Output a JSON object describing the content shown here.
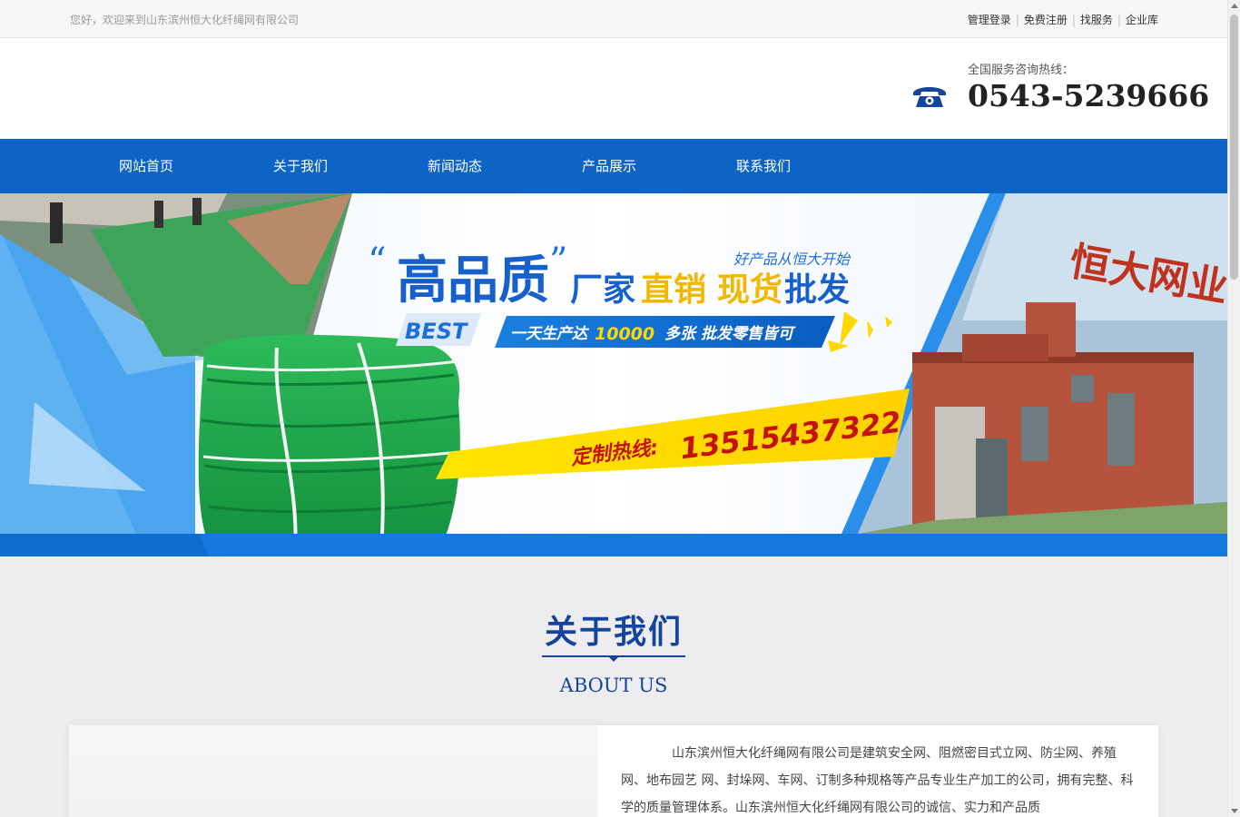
{
  "topbar": {
    "welcome": "您好，欢迎来到山东滨州恒大化纤绳网有限公司",
    "links": [
      "管理登录",
      "免费注册",
      "找服务",
      "企业库"
    ]
  },
  "header": {
    "hotline_label": "全国服务咨询热线：",
    "hotline_number": "0543-5239666",
    "phone_icon": "phone-icon"
  },
  "nav": {
    "items": [
      "网站首页",
      "关于我们",
      "新闻动态",
      "产品展示",
      "联系我们"
    ]
  },
  "banner": {
    "slogan_small": "好产品从恒大开始",
    "headline_1": "高品质",
    "headline_2a": "厂家",
    "headline_2b": "直销",
    "headline_2c": "现货",
    "headline_2d": "批发",
    "badge": "BEST",
    "capacity_pre": "一天生产达",
    "capacity_num": "10000",
    "capacity_post": "多张  批发零售皆可",
    "custom_label": "定制热线:",
    "custom_number": "13515437322",
    "sign_text": "恒大网业",
    "colors": {
      "nav_blue": "#0d64c5",
      "title_blue": "#14449c",
      "accent_yellow": "#ffd800",
      "net_green": "#1ea64a"
    }
  },
  "about": {
    "title": "关于我们",
    "subtitle": "ABOUT US",
    "text": "山东滨州恒大化纤绳网有限公司是建筑安全网、阻燃密目式立网、防尘网、养殖网、地布园艺 网、封垛网、车网、订制多种规格等产品专业生产加工的公司，拥有完整、科学的质量管理体系。山东滨州恒大化纤绳网有限公司的诚信、实力和产品质"
  }
}
